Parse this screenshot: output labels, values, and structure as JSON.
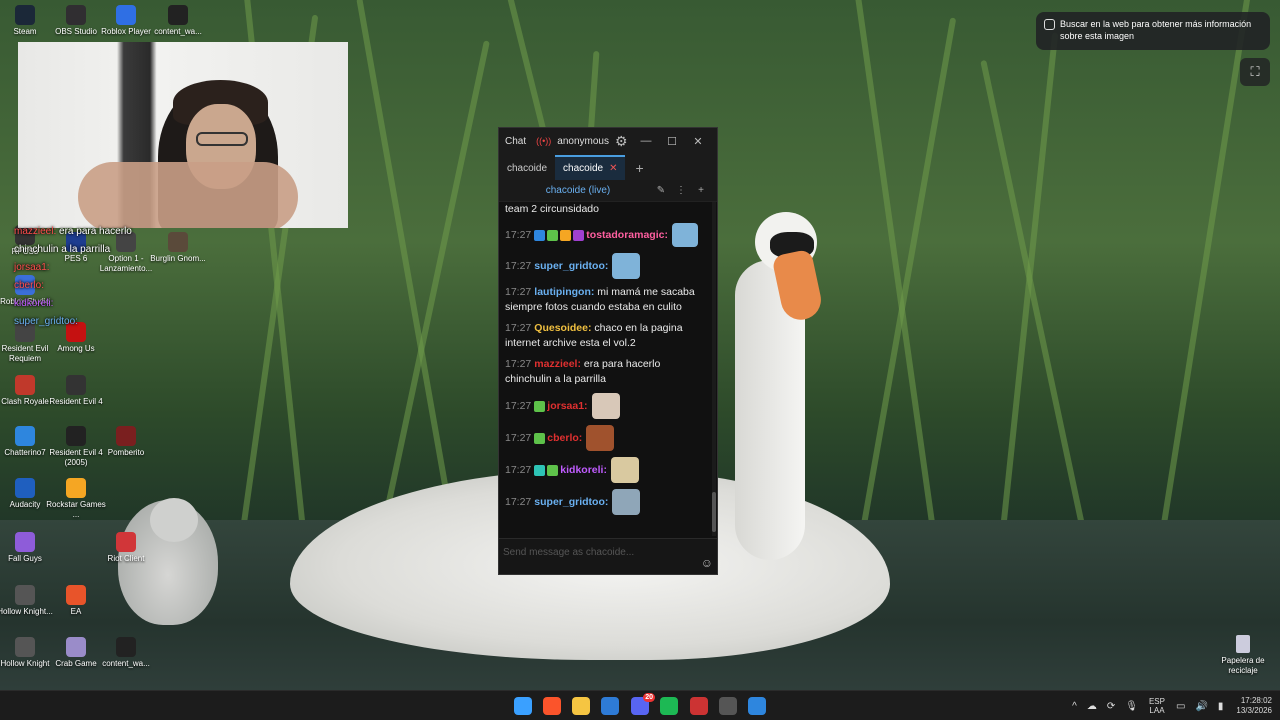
{
  "desktop": {
    "icons_left_col": [
      {
        "label": "Steam",
        "icon": "steam-icon",
        "color": "#1b2838"
      },
      {
        "label": "RPCS3",
        "icon": "ps3-icon",
        "color": "#333333"
      },
      {
        "label": "Roblox Studio",
        "icon": "roblox-studio-icon",
        "color": "#3b6fd9"
      },
      {
        "label": "Resident Evil Requiem",
        "icon": "re-requiem-icon",
        "color": "#444444"
      },
      {
        "label": "Clash Royale",
        "icon": "clash-royale-icon",
        "color": "#c0392b"
      },
      {
        "label": "Chatterino7",
        "icon": "chatterino-icon",
        "color": "#2e86de"
      },
      {
        "label": "Audacity",
        "icon": "audacity-icon",
        "color": "#1f5fbf"
      },
      {
        "label": "Fall Guys",
        "icon": "fall-guys-icon",
        "color": "#8e5cd9"
      },
      {
        "label": "Hollow Knight...",
        "icon": "hollow-knight-icon",
        "color": "#555555"
      },
      {
        "label": "Hollow Knight",
        "icon": "hollow-knight-icon",
        "color": "#555555"
      }
    ],
    "icons_second_col": [
      {
        "label": "OBS Studio",
        "icon": "obs-icon",
        "color": "#302e31"
      },
      {
        "label": "PES 6",
        "icon": "pes-icon",
        "color": "#1e3d8f"
      },
      {
        "label": "Among Us",
        "icon": "among-us-icon",
        "color": "#c51111"
      },
      {
        "label": "Resident Evil 4",
        "icon": "re4-icon",
        "color": "#333333"
      },
      {
        "label": "Resident Evil 4 (2005)",
        "icon": "re4-2005-icon",
        "color": "#222222"
      },
      {
        "label": "Rockstar Games ...",
        "icon": "rockstar-icon",
        "color": "#f5a623"
      },
      {
        "label": "EA",
        "icon": "ea-icon",
        "color": "#e8542a"
      },
      {
        "label": "Crab Game",
        "icon": "crab-game-icon",
        "color": "#9a8cc9"
      }
    ],
    "icons_third_col": [
      {
        "label": "Roblox Player",
        "icon": "roblox-player-icon",
        "color": "#2f6fe4"
      },
      {
        "label": "Option 1 - Lanzamiento...",
        "icon": "option1-icon",
        "color": "#444444"
      },
      {
        "label": "Pomberito",
        "icon": "pomberito-icon",
        "color": "#7a1f1f"
      },
      {
        "label": "Riot Client",
        "icon": "riot-client-icon",
        "color": "#d13639"
      },
      {
        "label": "content_wa...",
        "icon": "content-icon",
        "color": "#222222"
      }
    ],
    "icons_fourth_col": [
      {
        "label": "content_wa...",
        "icon": "content-icon",
        "color": "#222222"
      },
      {
        "label": "Burglin Gnom...",
        "icon": "burglin-gnomes-icon",
        "color": "#5a4a3a"
      }
    ],
    "recycle_bin": "Papelera de reciclaje"
  },
  "stream_overlay_chat": [
    {
      "user": "mazzieel:",
      "text": " era para hacerlo",
      "user_color": "#ff4d4d"
    },
    {
      "user": "",
      "text": "chinchulin a la parrilla",
      "user_color": "#ffffff"
    },
    {
      "user": "jorsaa1:",
      "text": "",
      "user_color": "#ff4d4d"
    },
    {
      "user": "cberlo:",
      "text": "",
      "user_color": "#ff4d4d"
    },
    {
      "user": "kidkoreli:",
      "text": "",
      "user_color": "#c05cff"
    },
    {
      "user": "super_gridtoo:",
      "text": "",
      "user_color": "#6ab0f0"
    }
  ],
  "lens": {
    "tooltip": "Buscar en la web para obtener más información sobre esta imagen",
    "button_icon": "lens-scan-icon"
  },
  "chat_window": {
    "title": "Chat",
    "live_indicator": "((•))",
    "account": "anonymous",
    "tabs": [
      {
        "label": "chacoide",
        "active": false
      },
      {
        "label": "chacoide",
        "active": true
      }
    ],
    "split_header": "chacoide (live)",
    "input_placeholder": "Send message as chacoide...",
    "messages": [
      {
        "time": "",
        "user": "",
        "text": "team 2 circunsidado",
        "user_color": "#ffffff"
      },
      {
        "time": "17:27",
        "user": "tostadoramagic:",
        "text": "",
        "user_color": "#ff5fa0",
        "badges": [
          "#2e86de",
          "#5ec24a",
          "#f5a623",
          "#a040d0"
        ],
        "emote": "#7fb3d9"
      },
      {
        "time": "17:27",
        "user": "super_gridtoo:",
        "text": "",
        "user_color": "#6ab0f0",
        "emote": "#7fb3d9"
      },
      {
        "time": "17:27",
        "user": "lautipingon:",
        "text": "mi mamá me sacaba siempre fotos cuando estaba en culito",
        "user_color": "#6ab0f0"
      },
      {
        "time": "17:27",
        "user": "Quesoidee:",
        "text": "chaco en la pagina internet archive esta el vol.2",
        "user_color": "#f0c040"
      },
      {
        "time": "17:27",
        "user": "mazzieel:",
        "text": "era para hacerlo chinchulin a la parrilla",
        "user_color": "#e03030"
      },
      {
        "time": "17:27",
        "user": "jorsaa1:",
        "text": "",
        "user_color": "#e03030",
        "badges": [
          "#5ec24a"
        ],
        "emote": "#d8c8b8"
      },
      {
        "time": "17:27",
        "user": "cberlo:",
        "text": "",
        "user_color": "#e03030",
        "badges": [
          "#5ec24a"
        ],
        "emote": "#a0522d"
      },
      {
        "time": "17:27",
        "user": "kidkoreli:",
        "text": "",
        "user_color": "#c05cff",
        "badges": [
          "#2ec4b6",
          "#5ec24a"
        ],
        "emote": "#d9c9a0"
      },
      {
        "time": "17:27",
        "user": "super_gridtoo:",
        "text": "",
        "user_color": "#6ab0f0",
        "emote": "#8fa6b8"
      }
    ]
  },
  "taskbar": {
    "apps": [
      {
        "name": "windows-start-icon",
        "color": "#3aa0ff"
      },
      {
        "name": "brave-icon",
        "color": "#fb542b"
      },
      {
        "name": "file-explorer-icon",
        "color": "#f5c542"
      },
      {
        "name": "bing-icon",
        "color": "#2e7bd6"
      },
      {
        "name": "discord-icon",
        "color": "#5865f2"
      },
      {
        "name": "spotify-icon",
        "color": "#1db954"
      },
      {
        "name": "calendar-app-icon",
        "color": "#cc3333"
      },
      {
        "name": "obs-taskbar-icon",
        "color": "#555555"
      },
      {
        "name": "chatterino-taskbar-icon",
        "color": "#2e86de"
      }
    ],
    "discord_badge": "20",
    "language_top": "ESP",
    "language_bottom": "LAA",
    "time": "17:28:02",
    "date": "13/3/2026"
  }
}
